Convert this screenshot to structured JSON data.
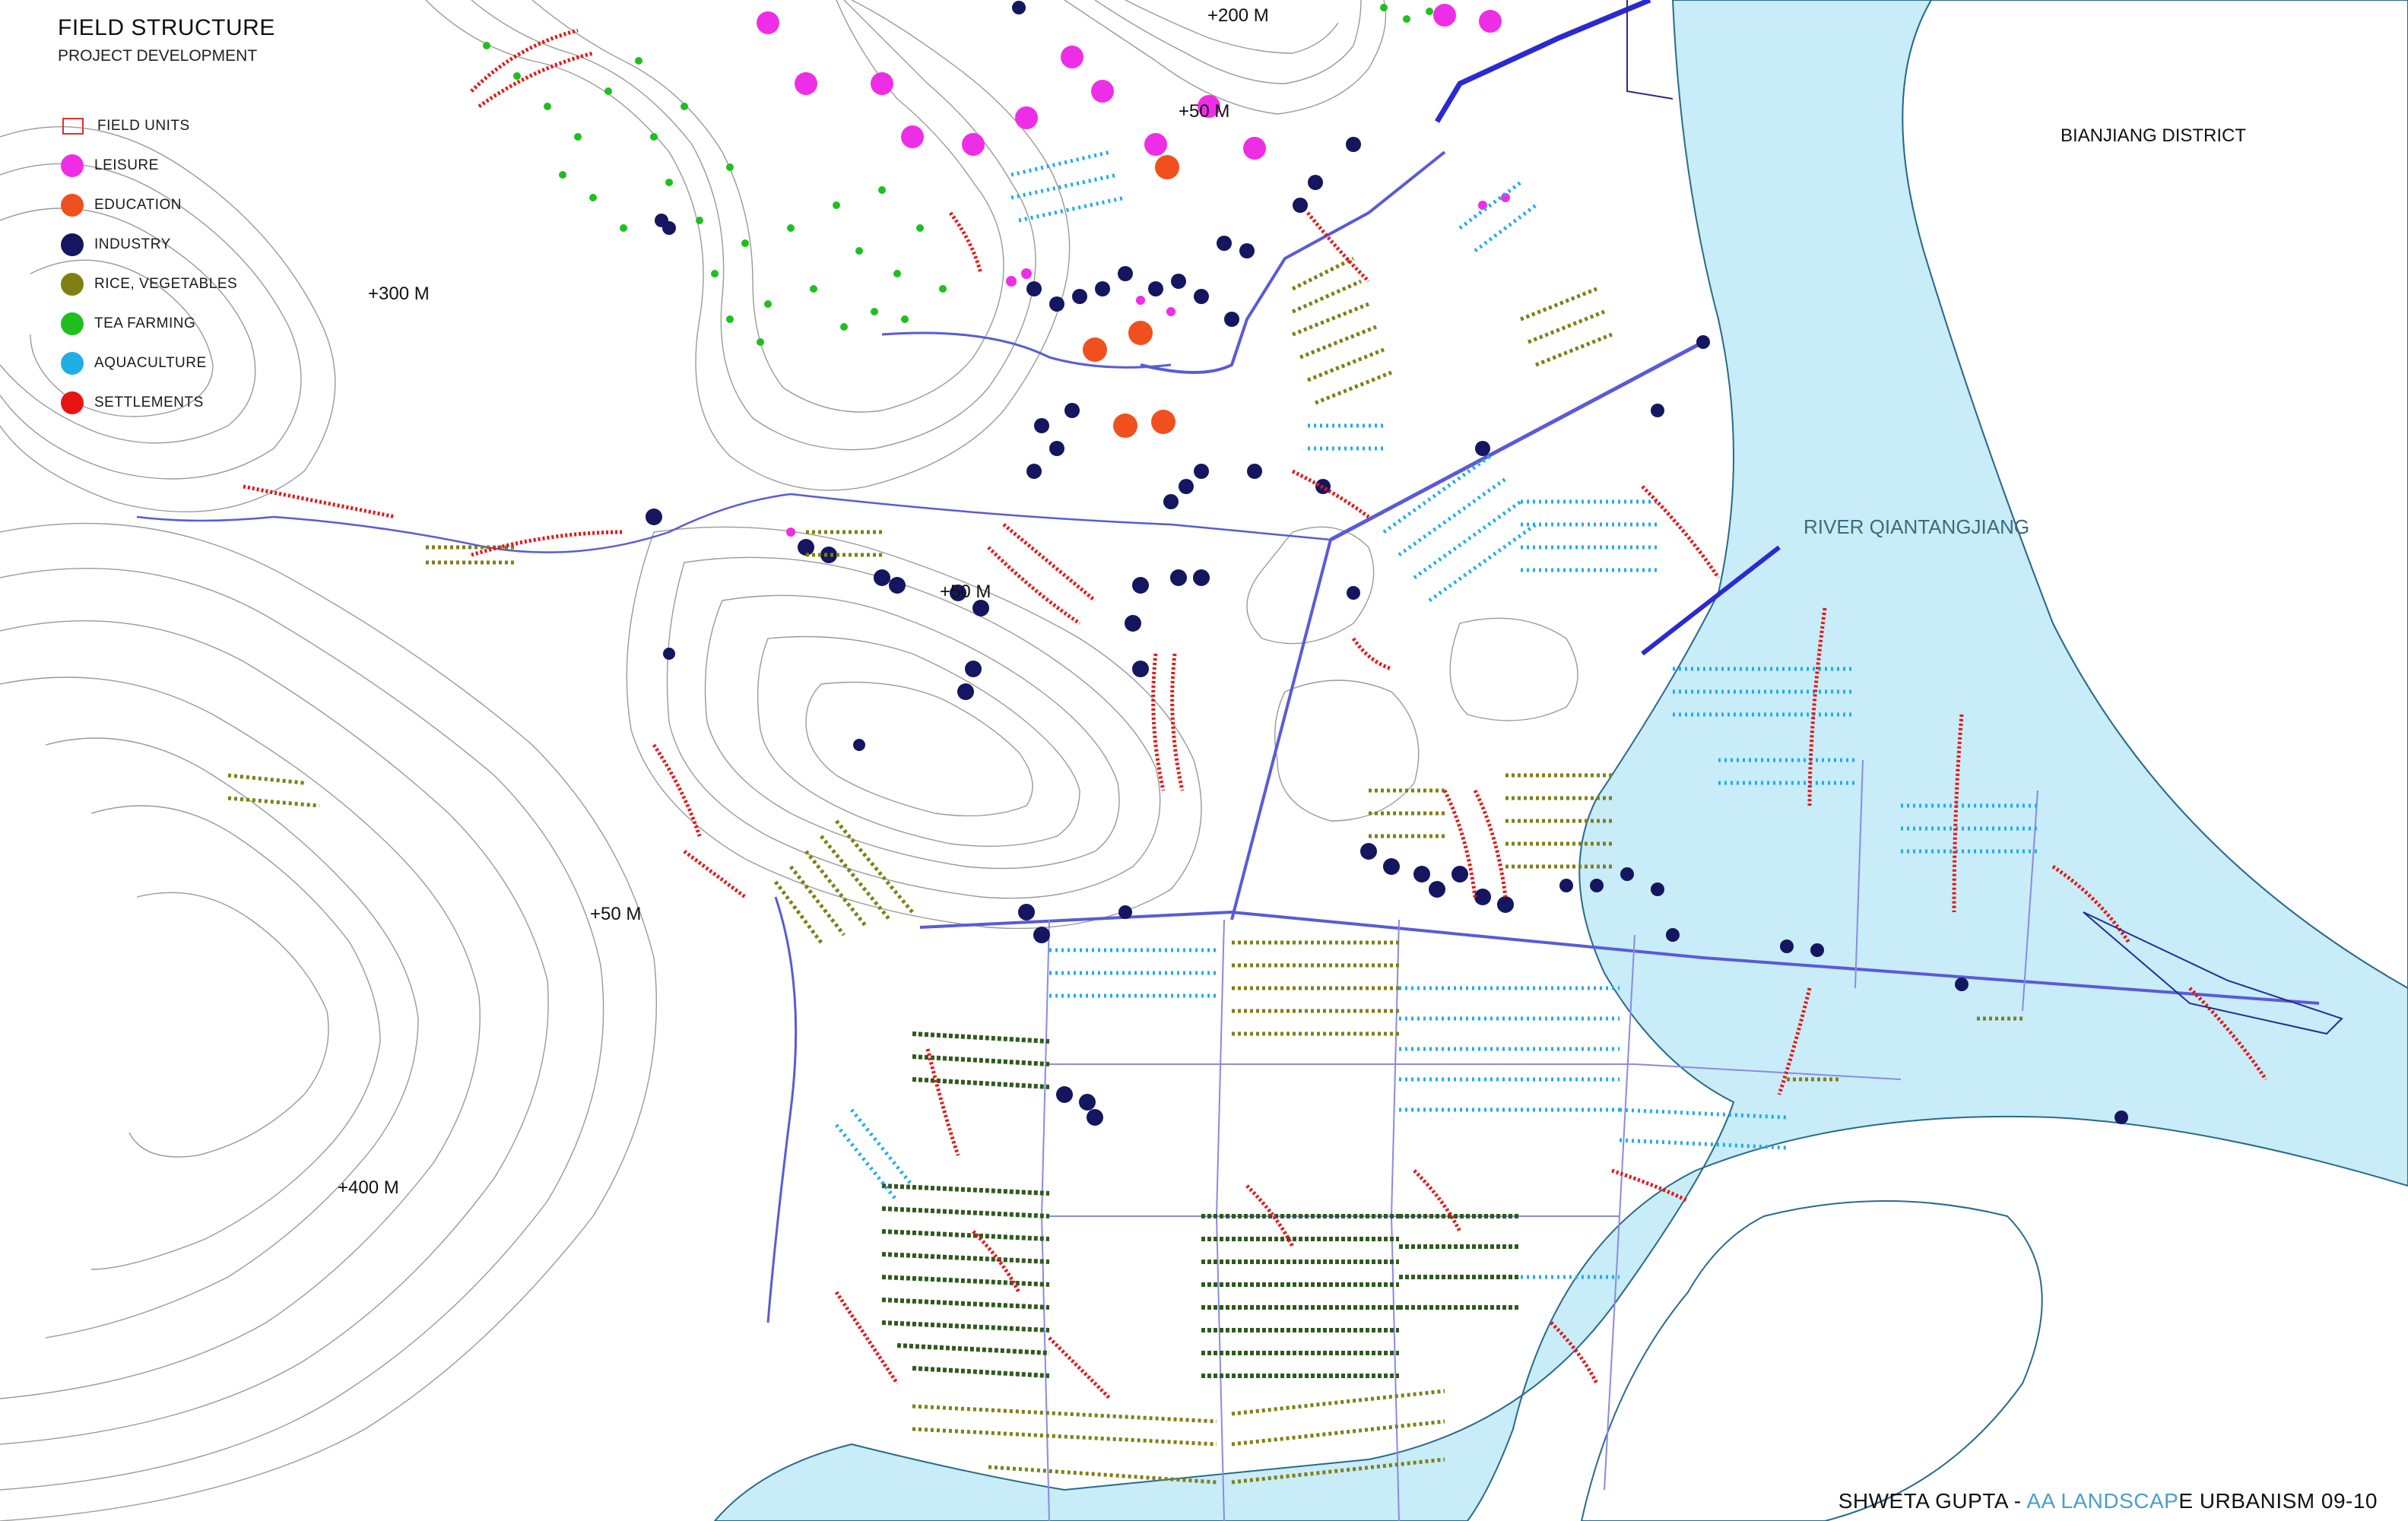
{
  "title": "FIELD STRUCTURE",
  "subtitle": "PROJECT DEVELOPMENT",
  "legend": [
    {
      "key": "field_units",
      "label": "FIELD UNITS",
      "color": "#e03030",
      "shape": "outline-box"
    },
    {
      "key": "leisure",
      "label": "LEISURE",
      "color": "#ee2ee6",
      "shape": "dot"
    },
    {
      "key": "education",
      "label": "EDUCATION",
      "color": "#f0501e",
      "shape": "dot"
    },
    {
      "key": "industry",
      "label": "INDUSTRY",
      "color": "#141660",
      "shape": "dot"
    },
    {
      "key": "rice",
      "label": "RICE, VEGETABLES",
      "color": "#7f7f14",
      "shape": "dot"
    },
    {
      "key": "tea",
      "label": "TEA FARMING",
      "color": "#1fbf1f",
      "shape": "dot"
    },
    {
      "key": "aquaculture",
      "label": "AQUACULTURE",
      "color": "#1faee6",
      "shape": "dot"
    },
    {
      "key": "settlements",
      "label": "SETTLEMENTS",
      "color": "#e81414",
      "shape": "dot"
    }
  ],
  "colors": {
    "river": "#c8ecf8",
    "contour": "#9a9a9a",
    "roads": "#5a5ad8",
    "farmland_dark": "#2f5a1e"
  },
  "labels": {
    "district": "BIANJIANG DISTRICT",
    "river": "RIVER QIANTANGJIANG",
    "elev_200": "+200 M",
    "elev_50_north": "+50 M",
    "elev_300": "+300 M",
    "elev_50_mid": "+50 M",
    "elev_50_west": "+50 M",
    "elev_400": "+400 M"
  },
  "credit": {
    "author": "SHWETA GUPTA - ",
    "school": "AA LANDSCAP",
    "rest": "E URBANISM 09-10"
  }
}
